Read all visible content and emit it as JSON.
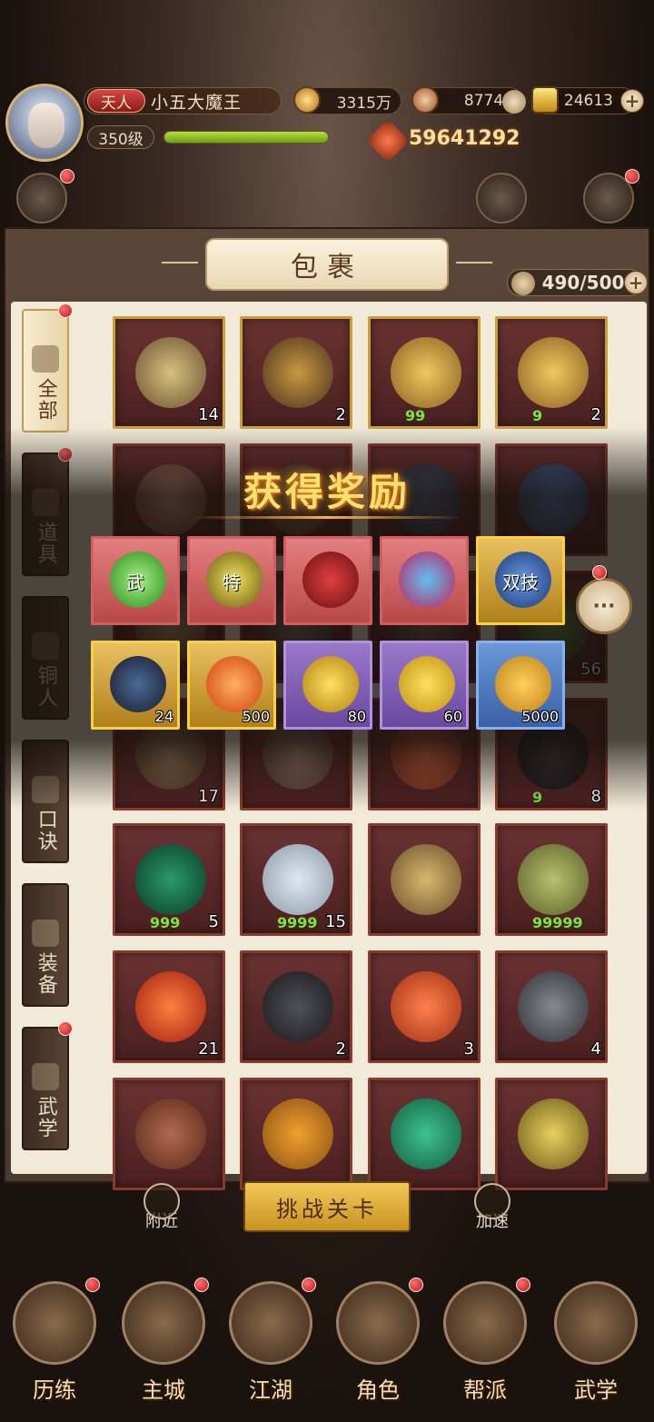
{
  "header": {
    "rank": "天人",
    "player_name": "小五大魔王",
    "level": "350级",
    "exp_progress": 1.0,
    "power": "59641292",
    "currencies": [
      {
        "name": "copper-coin",
        "value": "3315万"
      },
      {
        "name": "jade",
        "value": "87744"
      },
      {
        "name": "gold-ingot",
        "value": "24613"
      }
    ]
  },
  "bag": {
    "title": "包裹",
    "capacity": "490/500"
  },
  "tabs": [
    {
      "label": "全部",
      "active": true
    },
    {
      "label": "道具",
      "active": false
    },
    {
      "label": "铜人",
      "active": false
    },
    {
      "label": "口诀",
      "active": false
    },
    {
      "label": "装备",
      "active": false
    },
    {
      "label": "武学",
      "active": false
    }
  ],
  "items": [
    {
      "count": "14",
      "mark": ""
    },
    {
      "count": "2",
      "mark": ""
    },
    {
      "count": "",
      "mark": "99"
    },
    {
      "count": "2",
      "mark": "9"
    },
    {
      "count": "",
      "mark": ""
    },
    {
      "count": "",
      "mark": ""
    },
    {
      "count": "",
      "mark": ""
    },
    {
      "count": "",
      "mark": ""
    },
    {
      "count": "",
      "mark": ""
    },
    {
      "count": "",
      "mark": ""
    },
    {
      "count": "",
      "mark": ""
    },
    {
      "count": "56",
      "mark": ""
    },
    {
      "count": "17",
      "mark": ""
    },
    {
      "count": "",
      "mark": ""
    },
    {
      "count": "",
      "mark": ""
    },
    {
      "count": "8",
      "mark": "9"
    },
    {
      "count": "5",
      "mark": "999"
    },
    {
      "count": "15",
      "mark": "9999"
    },
    {
      "count": "",
      "mark": ""
    },
    {
      "count": "",
      "mark": "99999"
    },
    {
      "count": "21",
      "mark": ""
    },
    {
      "count": "2",
      "mark": ""
    },
    {
      "count": "3",
      "mark": ""
    },
    {
      "count": "4",
      "mark": ""
    },
    {
      "count": "",
      "mark": ""
    },
    {
      "count": "",
      "mark": ""
    },
    {
      "count": "",
      "mark": ""
    },
    {
      "count": "",
      "mark": ""
    }
  ],
  "reward_popup": {
    "title": "获得奖励",
    "rewards": [
      {
        "glyph": "武",
        "count": ""
      },
      {
        "glyph": "特",
        "count": ""
      },
      {
        "glyph": "",
        "count": ""
      },
      {
        "glyph": "",
        "count": ""
      },
      {
        "glyph": "双技",
        "count": ""
      },
      {
        "glyph": "",
        "count": "24"
      },
      {
        "glyph": "",
        "count": "500"
      },
      {
        "glyph": "",
        "count": "80"
      },
      {
        "glyph": "",
        "count": "60"
      },
      {
        "glyph": "",
        "count": "5000"
      }
    ]
  },
  "bottom": {
    "challenge_label": "挑战关卡",
    "nearby_label": "附近",
    "speedup_label": "加速"
  },
  "nav": [
    {
      "label": "历练"
    },
    {
      "label": "主城"
    },
    {
      "label": "江湖"
    },
    {
      "label": "角色"
    },
    {
      "label": "帮派"
    },
    {
      "label": "武学"
    }
  ]
}
